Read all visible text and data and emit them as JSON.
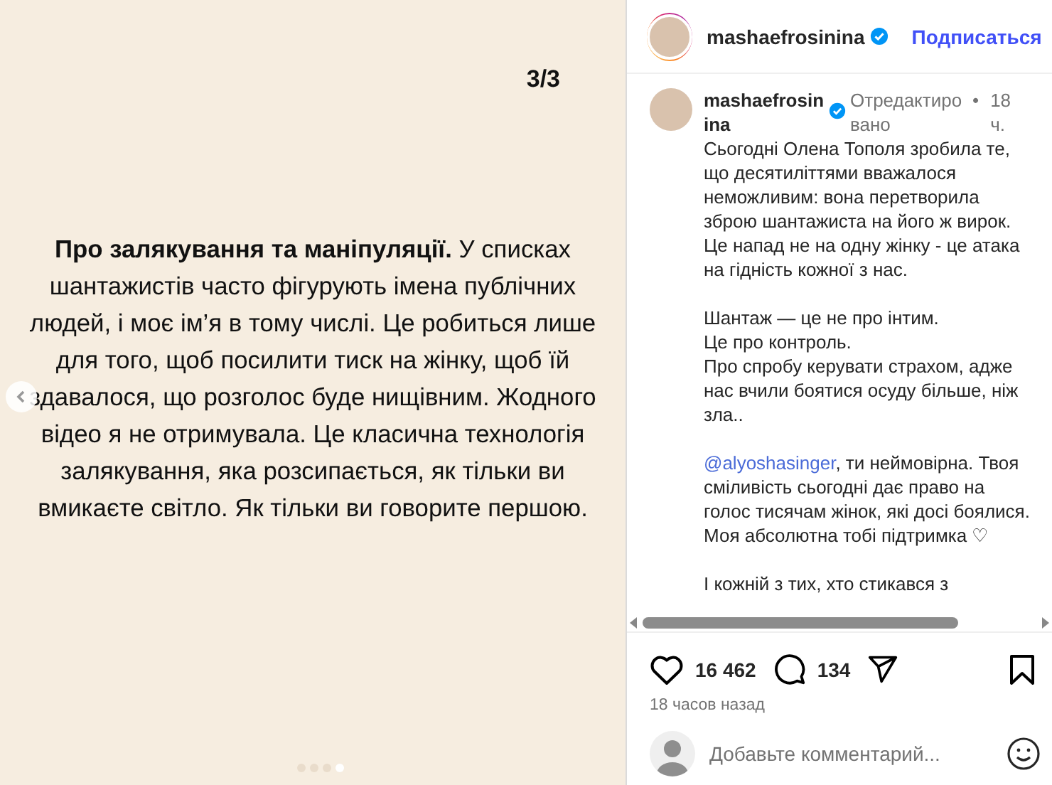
{
  "post": {
    "page_counter": "3/3",
    "text": "**Про залякування та маніпуляції.** У списках шантажистів часто фігурують імена публічних людей, і моє ім’я в тому числі. Це робиться лише для того, щоб посилити тиск на жінку, щоб їй здавалося, що розголос буде нищівним. Жодного відео я не отримувала. Це класична технологія залякування, яка розсипається, як тільки ви вмикаєте світло. Як тільки ви говорите першою.",
    "dots": [
      {
        "selected": false
      },
      {
        "selected": false
      },
      {
        "selected": false
      },
      {
        "selected": true
      }
    ]
  },
  "header": {
    "username": "mashaefrosinina",
    "verified": true,
    "follow_label": "Подписаться"
  },
  "caption": {
    "username": "mashaefrosinina",
    "verified": true,
    "edited": "Отредактировано",
    "separator": "•",
    "time": "18 ч.",
    "paragraphs": [
      {
        "lines": [
          "Сьогодні Олена Тополя зробила те, що десятиліттями вважалося неможливим: вона перетворила зброю шантажиста на його ж вирок. Це напад не на одну жінку - це атака на гідність кожної з нас."
        ]
      },
      {
        "lines": [
          "Шантаж — це не про інтим.",
          "Це про контроль.",
          "Про спробу керувати страхом, адже нас вчили боятися осуду більше, ніж зла.."
        ]
      },
      {
        "mention": "@alyoshasinger",
        "lines": [
          ", ти неймовірна. Твоя сміливість сьогодні дає право на голос тисячам жінок, які досі боялися. Моя абсолютна тобі підтримка ♡"
        ]
      },
      {
        "lines": [
          "І кожній з тих, хто стикався з"
        ]
      }
    ]
  },
  "actions": {
    "likes": "16 462",
    "comments": "134",
    "time_ago": "18 часов назад"
  },
  "comment_box": {
    "placeholder": "Добавьте комментарий..."
  }
}
